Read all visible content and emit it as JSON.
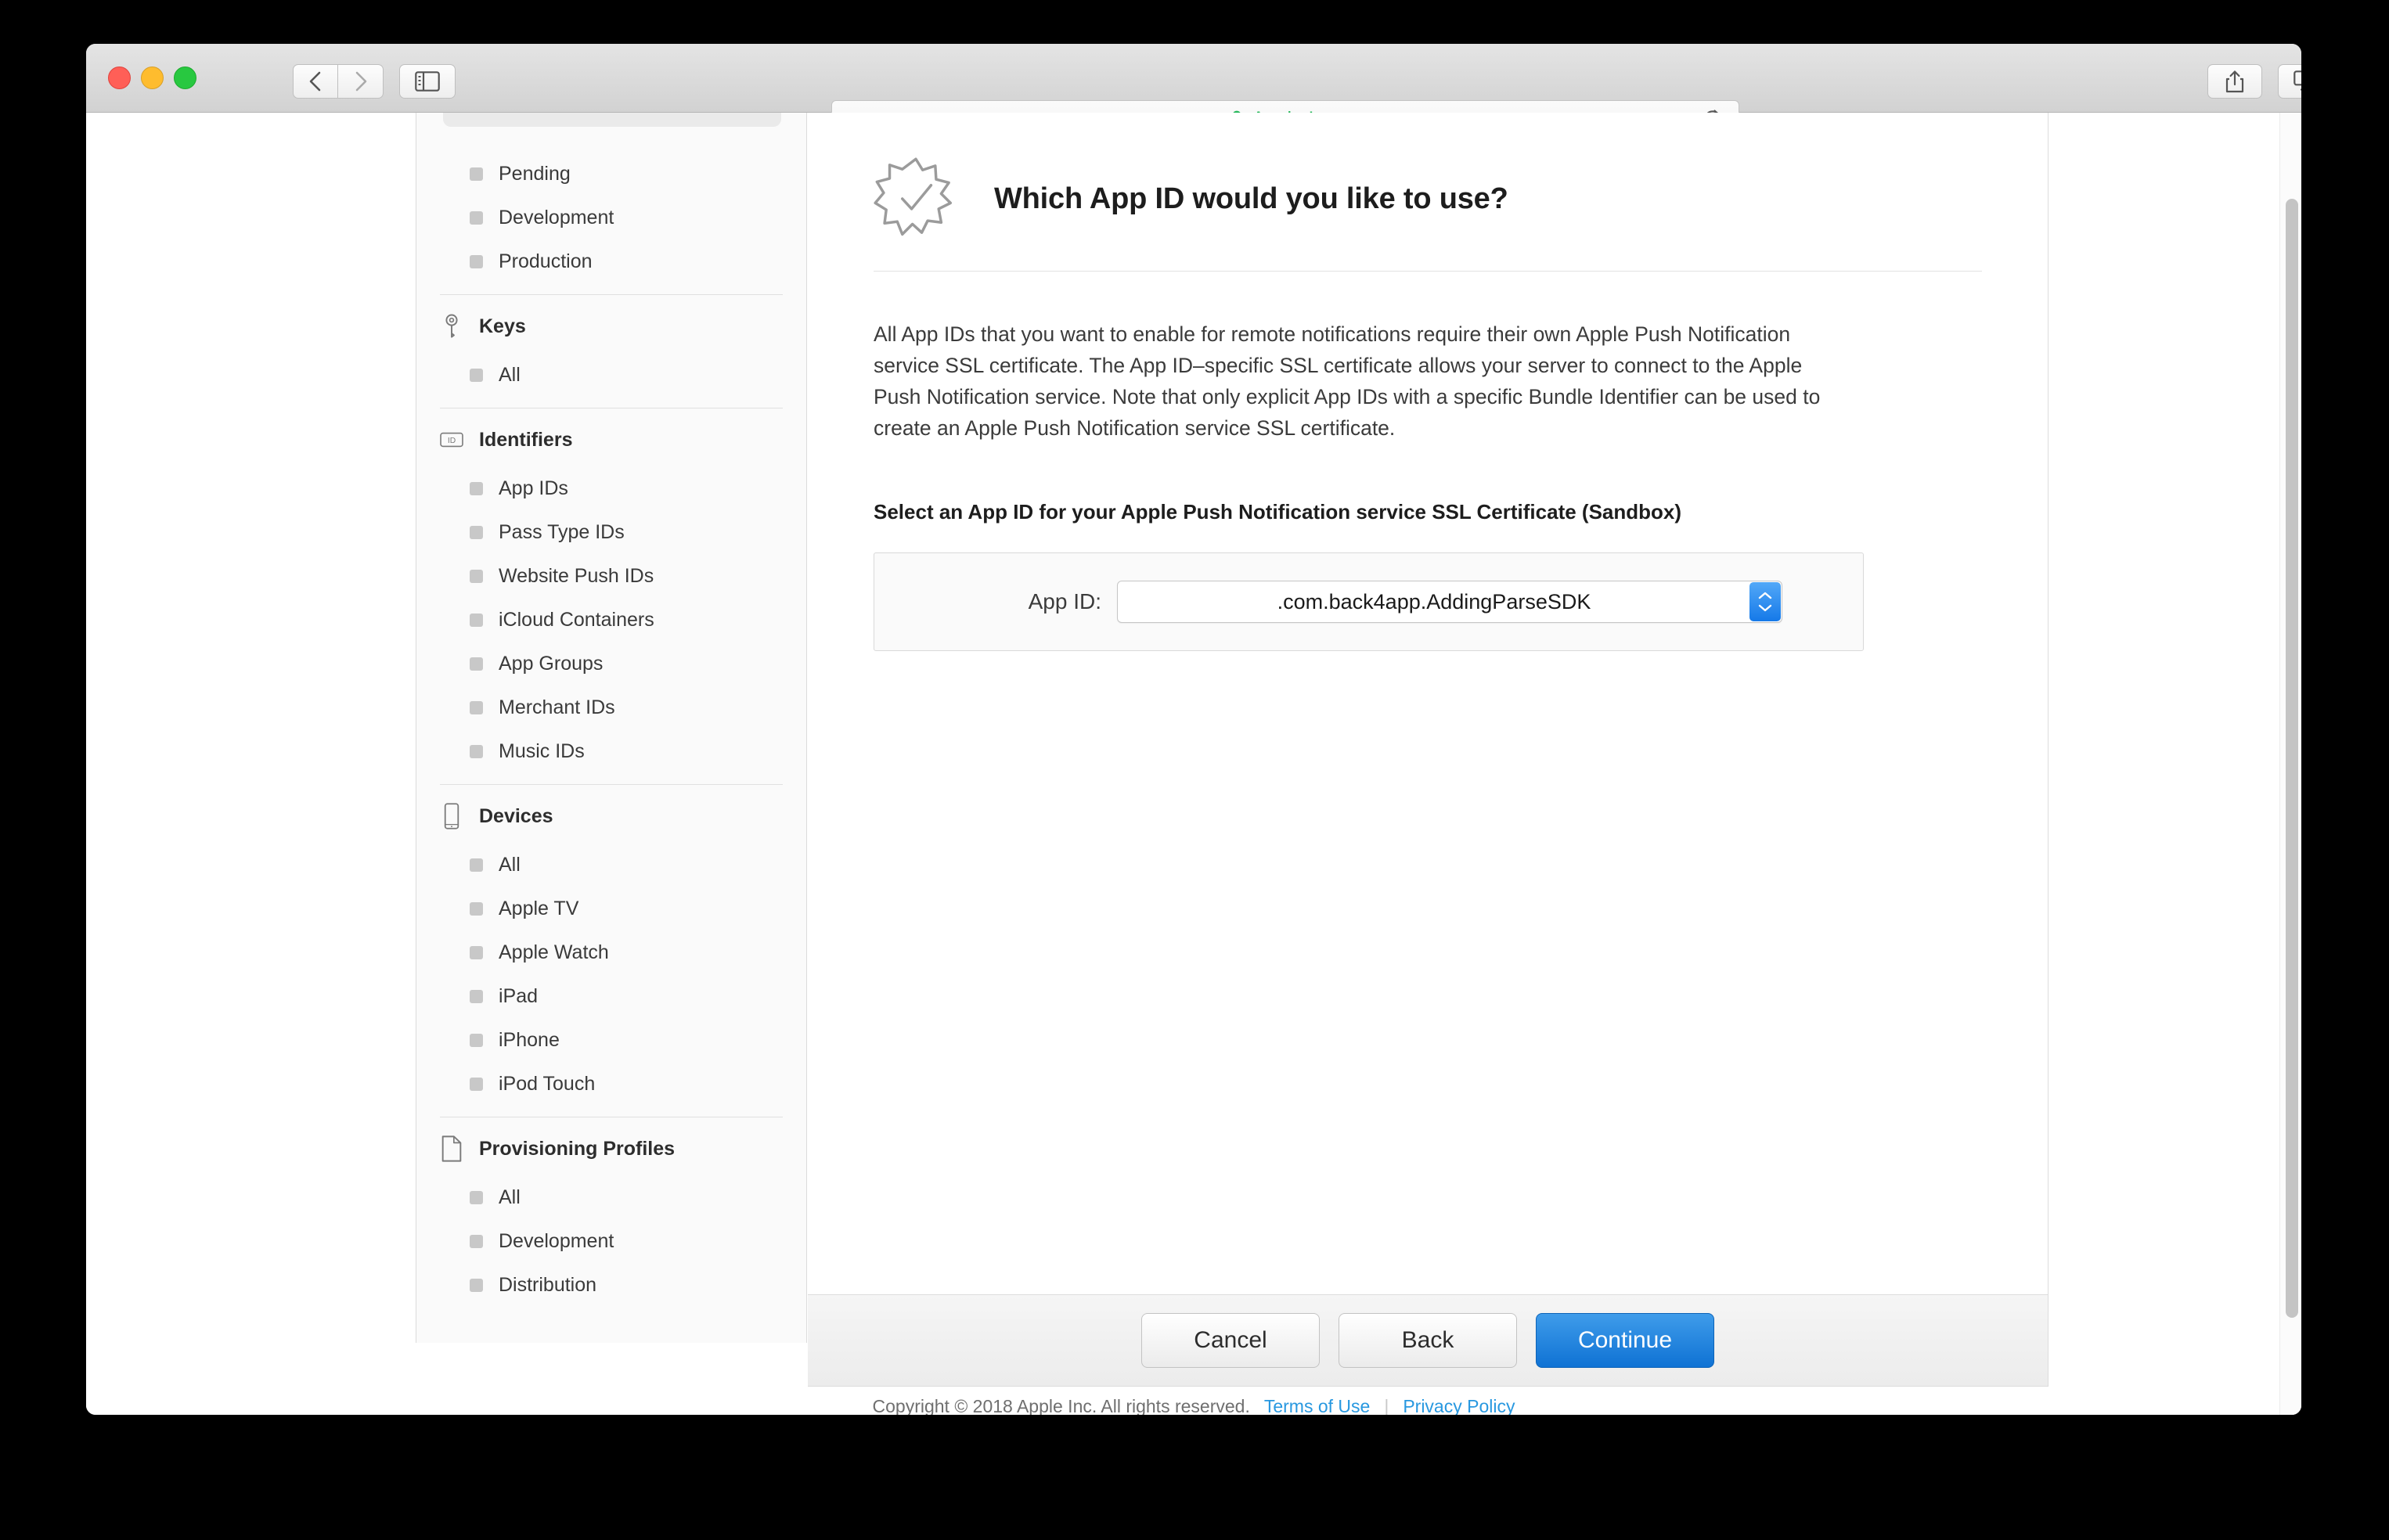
{
  "browser": {
    "site_title": "Apple Inc.",
    "lock_icon": "lock-icon",
    "window_controls": [
      "close",
      "minimize",
      "maximize"
    ],
    "back_label": "Back",
    "forward_label": "Forward",
    "new_tab_label": "+"
  },
  "sidebar": {
    "groups": [
      {
        "header": null,
        "icon": null,
        "items": [
          {
            "label": "Pending"
          },
          {
            "label": "Development"
          },
          {
            "label": "Production"
          }
        ]
      },
      {
        "header": "Keys",
        "icon": "key-icon",
        "items": [
          {
            "label": "All"
          }
        ]
      },
      {
        "header": "Identifiers",
        "icon": "id-icon",
        "items": [
          {
            "label": "App IDs"
          },
          {
            "label": "Pass Type IDs"
          },
          {
            "label": "Website Push IDs"
          },
          {
            "label": "iCloud Containers"
          },
          {
            "label": "App Groups"
          },
          {
            "label": "Merchant IDs"
          },
          {
            "label": "Music IDs"
          }
        ]
      },
      {
        "header": "Devices",
        "icon": "iphone-icon",
        "items": [
          {
            "label": "All"
          },
          {
            "label": "Apple TV"
          },
          {
            "label": "Apple Watch"
          },
          {
            "label": "iPad"
          },
          {
            "label": "iPhone"
          },
          {
            "label": "iPod Touch"
          }
        ]
      },
      {
        "header": "Provisioning Profiles",
        "icon": "document-icon",
        "items": [
          {
            "label": "All"
          },
          {
            "label": "Development"
          },
          {
            "label": "Distribution"
          }
        ]
      }
    ]
  },
  "main": {
    "badge_icon": "certificate-seal-check-icon",
    "title": "Which App ID would you like to use?",
    "intro": "All App IDs that you want to enable for remote notifications require their own Apple Push Notification service SSL certificate. The App ID–specific SSL certificate allows your server to connect to the Apple Push Notification service. Note that only explicit App IDs with a specific Bundle Identifier can be used to create an Apple Push Notification service SSL certificate.",
    "select_heading": "Select an App ID for your Apple Push Notification service SSL Certificate (Sandbox)",
    "appid_label": "App ID:",
    "appid_value": ".com.back4app.AddingParseSDK",
    "stepper_up": "⌃",
    "stepper_down": "⌄"
  },
  "buttons": {
    "cancel": "Cancel",
    "back": "Back",
    "continue": "Continue"
  },
  "footer": {
    "copyright": "Copyright © 2018 Apple Inc. All rights reserved.",
    "terms": "Terms of Use",
    "separator": "|",
    "privacy": "Privacy Policy"
  },
  "colors": {
    "accent_blue": "#1579e8",
    "link_blue": "#2898e0",
    "secure_green": "#28b85c"
  }
}
